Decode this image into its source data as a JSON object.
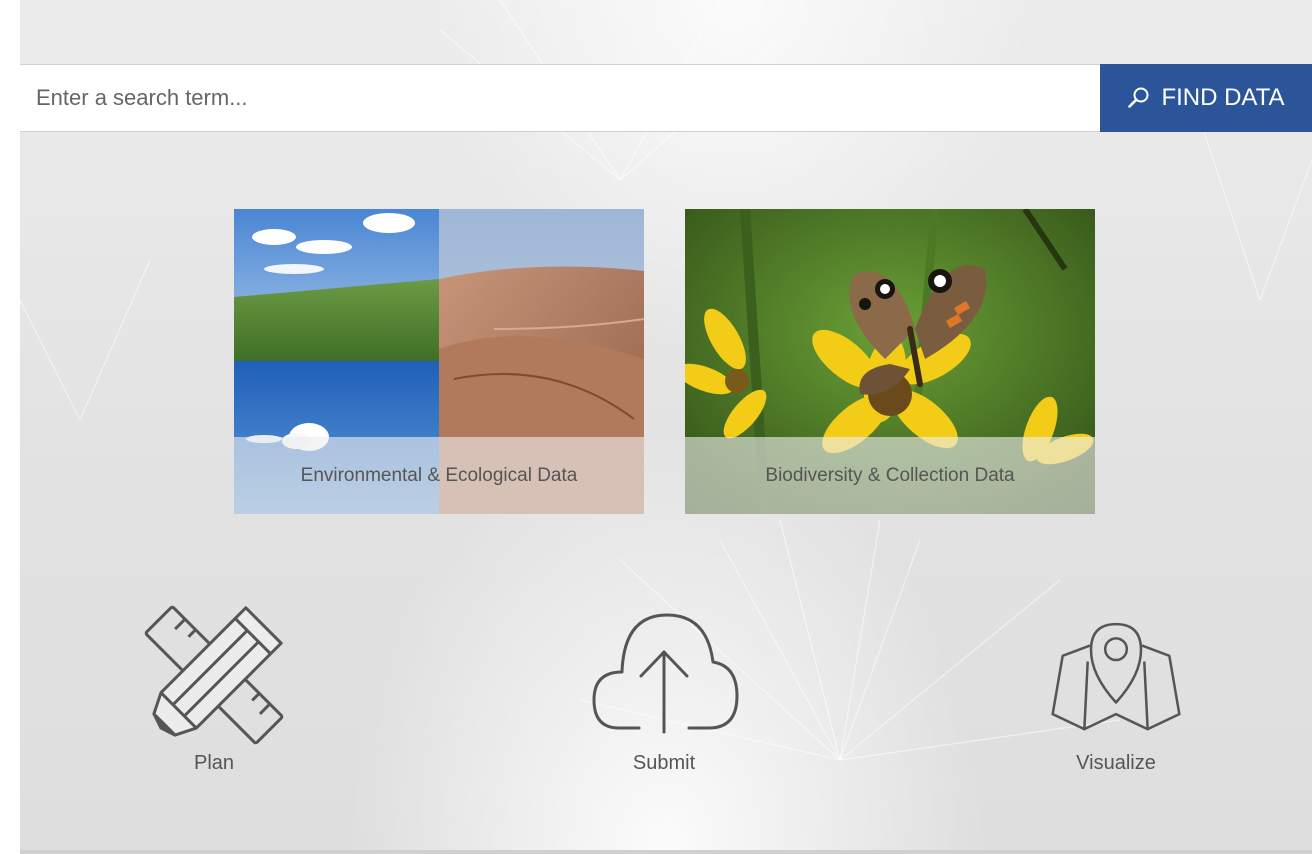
{
  "search": {
    "placeholder": "Enter a search term...",
    "value": "",
    "button_label": "FIND DATA",
    "button_icon": "search-icon",
    "button_color": "#2c5599"
  },
  "cards": [
    {
      "label": "Environmental & Ecological Data",
      "image": "landscape-collage"
    },
    {
      "label": "Biodiversity & Collection Data",
      "image": "butterfly-on-flower"
    }
  ],
  "features": [
    {
      "label": "Plan",
      "icon": "pencil-ruler-icon"
    },
    {
      "label": "Submit",
      "icon": "cloud-upload-icon"
    },
    {
      "label": "Visualize",
      "icon": "map-pin-icon"
    }
  ]
}
